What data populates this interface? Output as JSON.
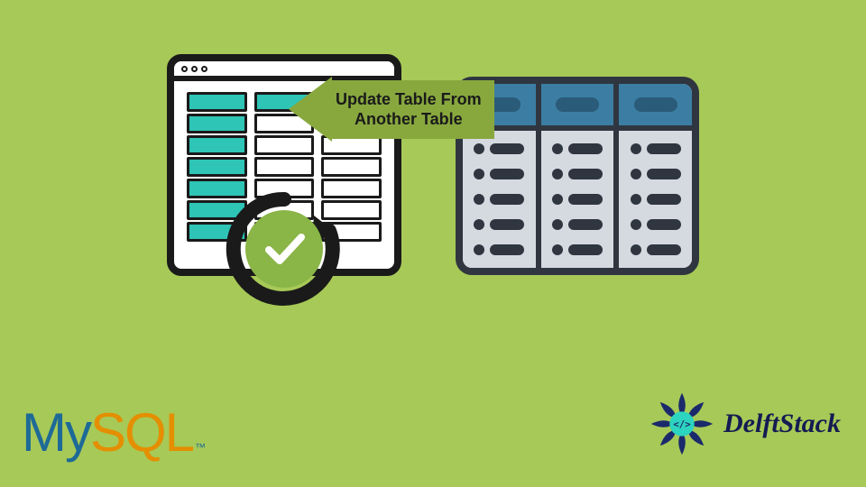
{
  "callout": {
    "line1": "Update Table From",
    "line2": "Another Table"
  },
  "logos": {
    "mysql_my": "My",
    "mysql_sql": "SQL",
    "mysql_tm": "™",
    "delftstack": "DelftStack"
  },
  "colors": {
    "bg": "#a7c957",
    "teal": "#2ec4b6",
    "outline": "#1a1a1a",
    "db_header": "#3c7ea3",
    "db_body": "#d5d9e0",
    "arrow": "#88a83e",
    "mysql_blue": "#1e6a97",
    "mysql_orange": "#e48e00",
    "delft_navy": "#141b52"
  },
  "left_table": {
    "rows": 7,
    "columns": 3,
    "first_column_accent": "teal"
  },
  "right_table": {
    "columns": 3,
    "rows_per_column": 5
  }
}
